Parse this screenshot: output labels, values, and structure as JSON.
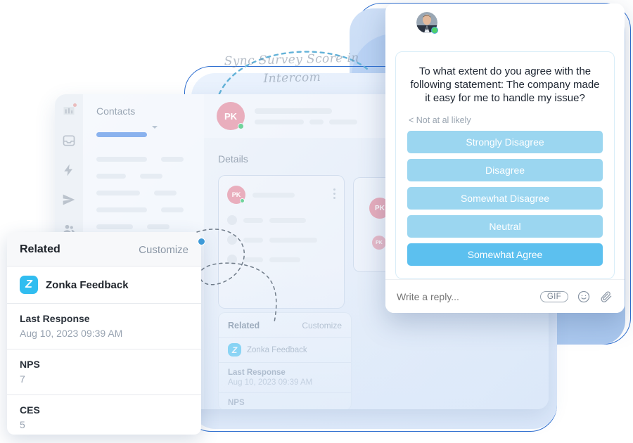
{
  "caption": {
    "line1": "Sync Survey Score in",
    "line2": "Intercom"
  },
  "app_window": {
    "rail_icons": [
      {
        "name": "reports-icon",
        "badge": true
      },
      {
        "name": "inbox-icon",
        "badge": false
      },
      {
        "name": "automation-bolt-icon",
        "badge": false
      },
      {
        "name": "send-message-icon",
        "badge": false
      },
      {
        "name": "contacts-people-icon",
        "badge": false
      },
      {
        "name": "knowledge-book-icon",
        "badge": false
      }
    ],
    "contacts_title": "Contacts",
    "details_title": "Details",
    "avatar_initials": "PK"
  },
  "related_ghost": {
    "title": "Related",
    "customize": "Customize",
    "brand": "Zonka Feedback",
    "brand_logo": "Z",
    "rows": [
      {
        "label": "Last Response",
        "value": "Aug 10, 2023 09:39 AM"
      },
      {
        "label": "NPS",
        "value": ""
      }
    ]
  },
  "related_card": {
    "title": "Related",
    "customize": "Customize",
    "brand": "Zonka Feedback",
    "brand_logo": "Z",
    "rows": [
      {
        "label": "Last Response",
        "value": "Aug 10, 2023 09:39 AM"
      },
      {
        "label": "NPS",
        "value": "7"
      },
      {
        "label": "CES",
        "value": "5"
      }
    ]
  },
  "chat": {
    "header": {
      "back_icon": "back-chevron-icon",
      "status": "online"
    },
    "question": "To what extent do you agree with the following statement: The company made it easy for me to handle my issue?",
    "scale_hint": "< Not at al likely",
    "options": [
      {
        "label": "Strongly Disagree",
        "selected": false
      },
      {
        "label": "Disagree",
        "selected": false
      },
      {
        "label": "Somewhat Disagree",
        "selected": false
      },
      {
        "label": "Neutral",
        "selected": false
      },
      {
        "label": "Somewhat Agree",
        "selected": true
      }
    ],
    "footer": {
      "reply_placeholder": "Write a reply...",
      "gif_label": "GIF",
      "emoji_icon": "smiley-icon",
      "attach_icon": "paperclip-icon"
    }
  },
  "colors": {
    "chat_header": "#4ba8d6",
    "option": "#9bd6f0",
    "option_active": "#5cc0ef",
    "accent_dot": "#3e9ad8",
    "zonka_logo": "#31bdf0",
    "avatar_pk": "#e9aebd",
    "online": "#4fd16a"
  }
}
